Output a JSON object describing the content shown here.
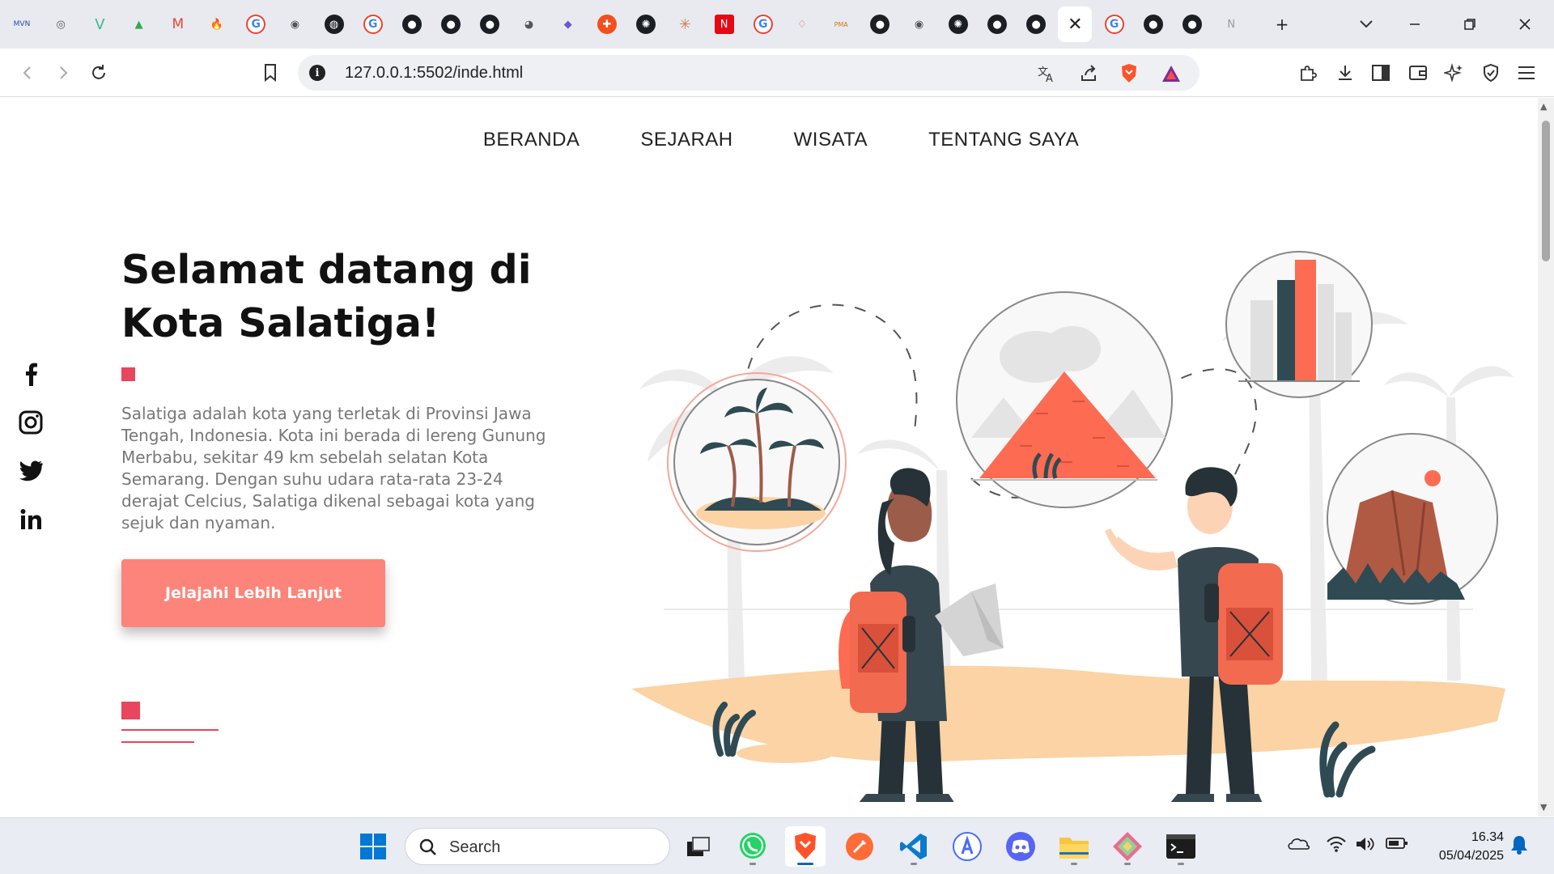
{
  "browser": {
    "tabs": [
      {
        "icon": "mvn-icon",
        "text": "MVN"
      },
      {
        "icon": "target-icon",
        "text": "◎"
      },
      {
        "icon": "vue-icon",
        "text": "V"
      },
      {
        "icon": "drive-icon",
        "text": "▲"
      },
      {
        "icon": "gmail-icon",
        "text": "M"
      },
      {
        "icon": "firebase-icon",
        "text": "🔥"
      },
      {
        "icon": "google-icon",
        "text": "G"
      },
      {
        "icon": "globe-icon",
        "text": "◉"
      },
      {
        "icon": "chatgpt-icon",
        "text": "◍"
      },
      {
        "icon": "google-icon",
        "text": "G"
      },
      {
        "icon": "github-icon",
        "text": "●"
      },
      {
        "icon": "github-icon",
        "text": "●"
      },
      {
        "icon": "github-icon",
        "text": "●"
      },
      {
        "icon": "avatar-icon",
        "text": "◕"
      },
      {
        "icon": "cube-icon",
        "text": "◆"
      },
      {
        "icon": "figma-icon",
        "text": "✚"
      },
      {
        "icon": "openai-icon",
        "text": "✺"
      },
      {
        "icon": "claude-icon",
        "text": "✳"
      },
      {
        "icon": "netflix-icon",
        "text": "N"
      },
      {
        "icon": "google-icon",
        "text": "G"
      },
      {
        "icon": "laravel-icon",
        "text": "♢"
      },
      {
        "icon": "phpmyadmin-icon",
        "text": "PMA"
      },
      {
        "icon": "github-icon",
        "text": "●"
      },
      {
        "icon": "globe-icon",
        "text": "◉"
      },
      {
        "icon": "openai-icon",
        "text": "✺"
      },
      {
        "icon": "github-icon",
        "text": "●"
      },
      {
        "icon": "github-icon",
        "text": "●"
      },
      {
        "icon": "close-icon",
        "text": "✕",
        "active": true
      },
      {
        "icon": "google-icon",
        "text": "G"
      },
      {
        "icon": "github-icon",
        "text": "●"
      },
      {
        "icon": "github-icon",
        "text": "●"
      },
      {
        "icon": "notion-icon",
        "text": "N"
      }
    ],
    "new_tab": "+",
    "url": "127.0.0.1:5502/inde.html"
  },
  "page": {
    "nav": [
      "BERANDA",
      "SEJARAH",
      "WISATA",
      "TENTANG SAYA"
    ],
    "title": "Selamat datang di Kota Salatiga!",
    "description": "Salatiga adalah kota yang terletak di Provinsi Jawa Tengah, Indonesia. Kota ini berada di lereng Gunung Merbabu, sekitar 49 km sebelah selatan Kota Semarang. Dengan suhu udara rata-rata 23-24 derajat Celcius, Salatiga dikenal sebagai kota yang sejuk dan nyaman.",
    "cta": "Jelajahi Lebih Lanjut",
    "social": [
      "facebook-icon",
      "instagram-icon",
      "twitter-icon",
      "linkedin-icon"
    ],
    "accent": "#e8455e",
    "button_color": "#fc847a"
  },
  "taskbar": {
    "search_label": "Search",
    "time": "16.34",
    "date": "05/04/2025"
  }
}
